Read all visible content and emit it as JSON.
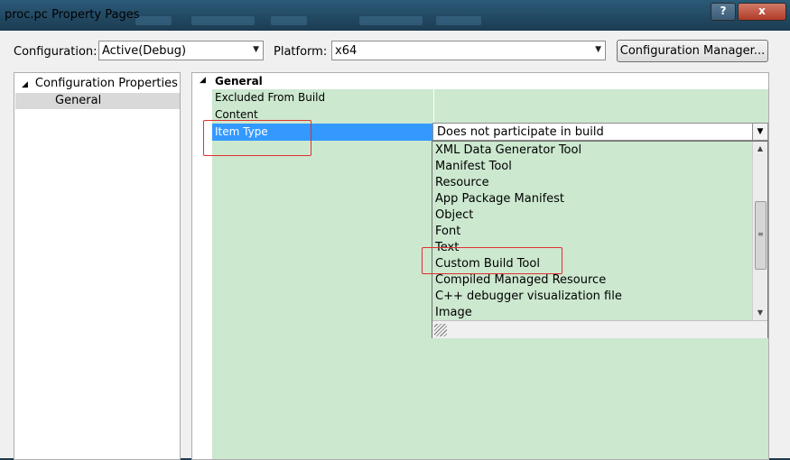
{
  "window": {
    "title": "proc.pc Property Pages",
    "help_label": "?",
    "close_label": "x"
  },
  "config_bar": {
    "configuration_label": "Configuration:",
    "configuration_value": "Active(Debug)",
    "platform_label": "Platform:",
    "platform_value": "x64",
    "config_manager_label": "Configuration Manager..."
  },
  "tree": {
    "root_label": "Configuration Properties",
    "children": [
      "General"
    ]
  },
  "grid": {
    "category": "General",
    "properties": [
      {
        "name": "Excluded From Build",
        "value": ""
      },
      {
        "name": "Content",
        "value": ""
      },
      {
        "name": "Item Type",
        "value": "Does not participate in build",
        "selected": true
      }
    ]
  },
  "dropdown": {
    "options": [
      "XML Data Generator Tool",
      "Manifest Tool",
      "Resource",
      "App Package Manifest",
      "Object",
      "Font",
      "Text",
      "Custom Build Tool",
      "Compiled Managed Resource",
      "C++ debugger visualization file",
      "Image"
    ]
  },
  "annotations": {
    "highlight_color": "#e03030"
  },
  "colors": {
    "grid_bg": "#cce8cf",
    "selection": "#3399ff"
  }
}
